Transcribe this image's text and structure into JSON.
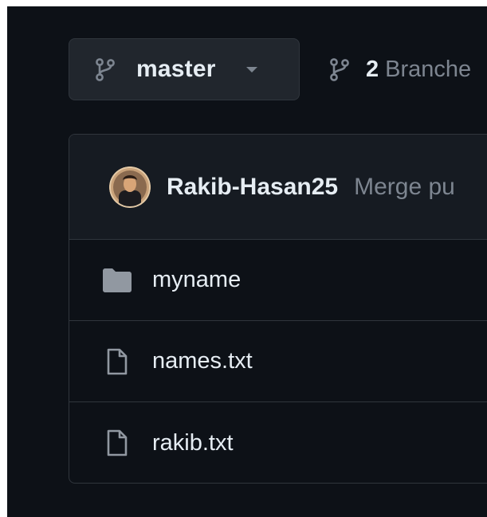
{
  "branch_selector": {
    "current_branch": "master",
    "icon": "git-branch-icon"
  },
  "branches_link": {
    "count": "2",
    "label": "Branche",
    "icon": "git-branch-icon"
  },
  "latest_commit": {
    "author": "Rakib-Hasan25",
    "message": "Merge pu",
    "avatar": "avatar"
  },
  "files": [
    {
      "name": "myname",
      "type": "directory",
      "icon": "folder-icon"
    },
    {
      "name": "names.txt",
      "type": "file",
      "icon": "file-icon"
    },
    {
      "name": "rakib.txt",
      "type": "file",
      "icon": "file-icon"
    }
  ],
  "colors": {
    "background": "#0d1117",
    "button_bg": "#21262d",
    "header_bg": "#161b22",
    "border": "#30363d",
    "text_primary": "#e6edf3",
    "text_muted": "#7d8590",
    "icon": "#7d8590",
    "folder": "#9198a1"
  }
}
